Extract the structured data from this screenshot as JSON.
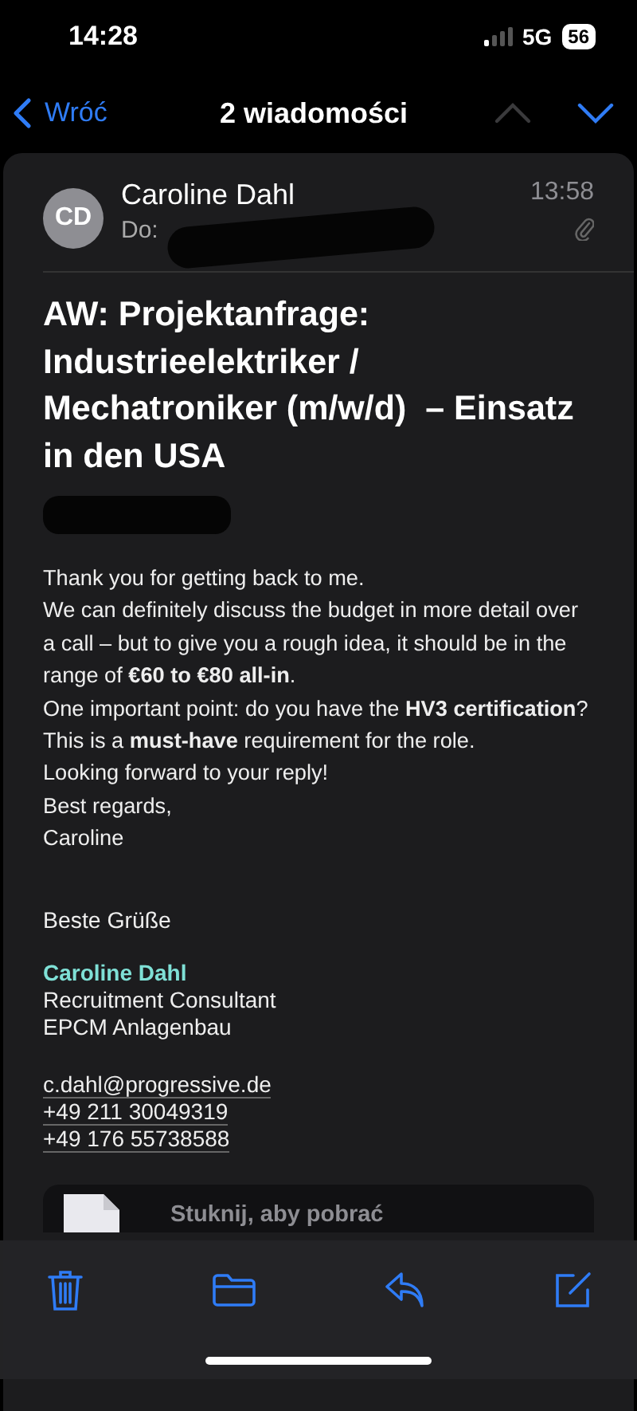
{
  "status_bar": {
    "time": "14:28",
    "network": "5G",
    "battery": "56"
  },
  "nav": {
    "back": "Wróć",
    "title": "2 wiadomości",
    "prev_disabled": true,
    "next_disabled": false
  },
  "message": {
    "avatar": "CD",
    "sender": "Caroline Dahl",
    "to_label": "Do:",
    "time": "13:58",
    "has_attachment": true,
    "subject": "AW: Projektanfrage: Industrieelektriker / Mechatroniker (m/w/d)  – Einsatz in den USA",
    "body": [
      "Thank you for getting back to me.",
      "We can definitely discuss the budget in more detail over a call – but to give you a rough idea, it should be in the range of **€60 to €80 all-in**.",
      "One important point: do you have the **HV3 certification**?",
      "This is a **must-have** requirement for the role.",
      "Looking forward to your reply!",
      "Best regards,",
      "Caroline"
    ],
    "closing": "Beste Grüße",
    "signature": {
      "name": "Caroline Dahl",
      "lines": [
        "Recruitment Consultant",
        "EPCM Anlagenbau"
      ],
      "links": [
        "c.dahl@progressive.de",
        "+49 211 30049319",
        "+49 176 55738588"
      ]
    },
    "attachment": {
      "label": "Stuknij, aby pobrać"
    }
  },
  "toolbar": [
    {
      "kind": "trash"
    },
    {
      "kind": "folder"
    },
    {
      "kind": "reply"
    },
    {
      "kind": "compose"
    }
  ]
}
